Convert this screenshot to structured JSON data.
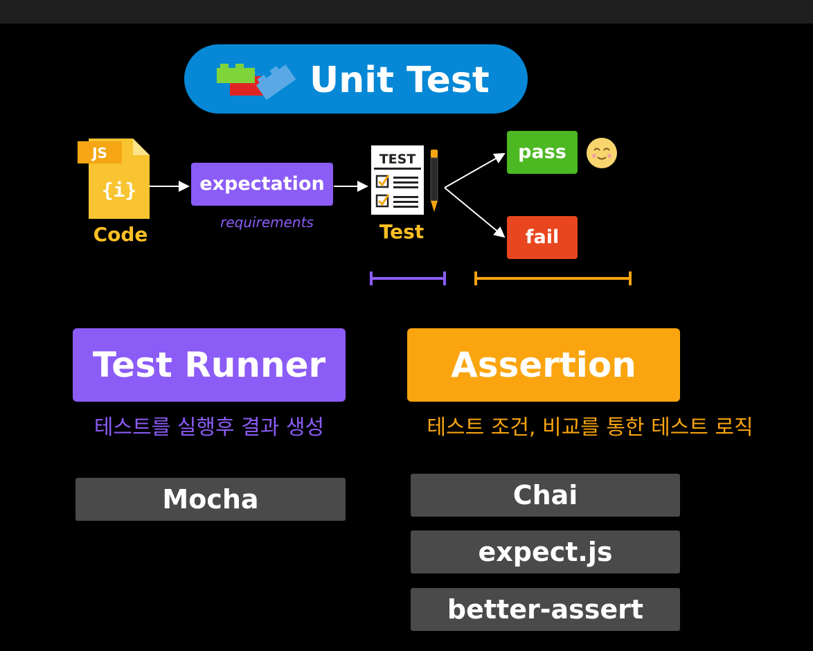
{
  "title": "Unit Test",
  "flow": {
    "code_badge": "JS",
    "code_glyph": "{i}",
    "code_label": "Code",
    "expectation_label": "expectation",
    "requirements_label": "requirements",
    "test_sheet_heading": "TEST",
    "test_label": "Test",
    "pass_label": "pass",
    "fail_label": "fail"
  },
  "test_runner": {
    "heading": "Test Runner",
    "description": "테스트를 실행후 결과 생성",
    "libraries": [
      "Mocha"
    ]
  },
  "assertion": {
    "heading": "Assertion",
    "description": "테스트 조건, 비교를 통한 테스트 로직",
    "libraries": [
      "Chai",
      "expect.js",
      "better-assert"
    ]
  },
  "colors": {
    "title_blue": "#0688d6",
    "purple": "#8b5cf6",
    "orange": "#faa50f",
    "pass_green": "#4cb822",
    "fail_red": "#e8461f",
    "label_yellow": "#fbbf24",
    "library_gray": "#4a4a4a"
  },
  "icons": [
    "lego-blocks-icon",
    "js-file-icon",
    "test-sheet-icon",
    "pencil-icon",
    "smiley-icon"
  ]
}
